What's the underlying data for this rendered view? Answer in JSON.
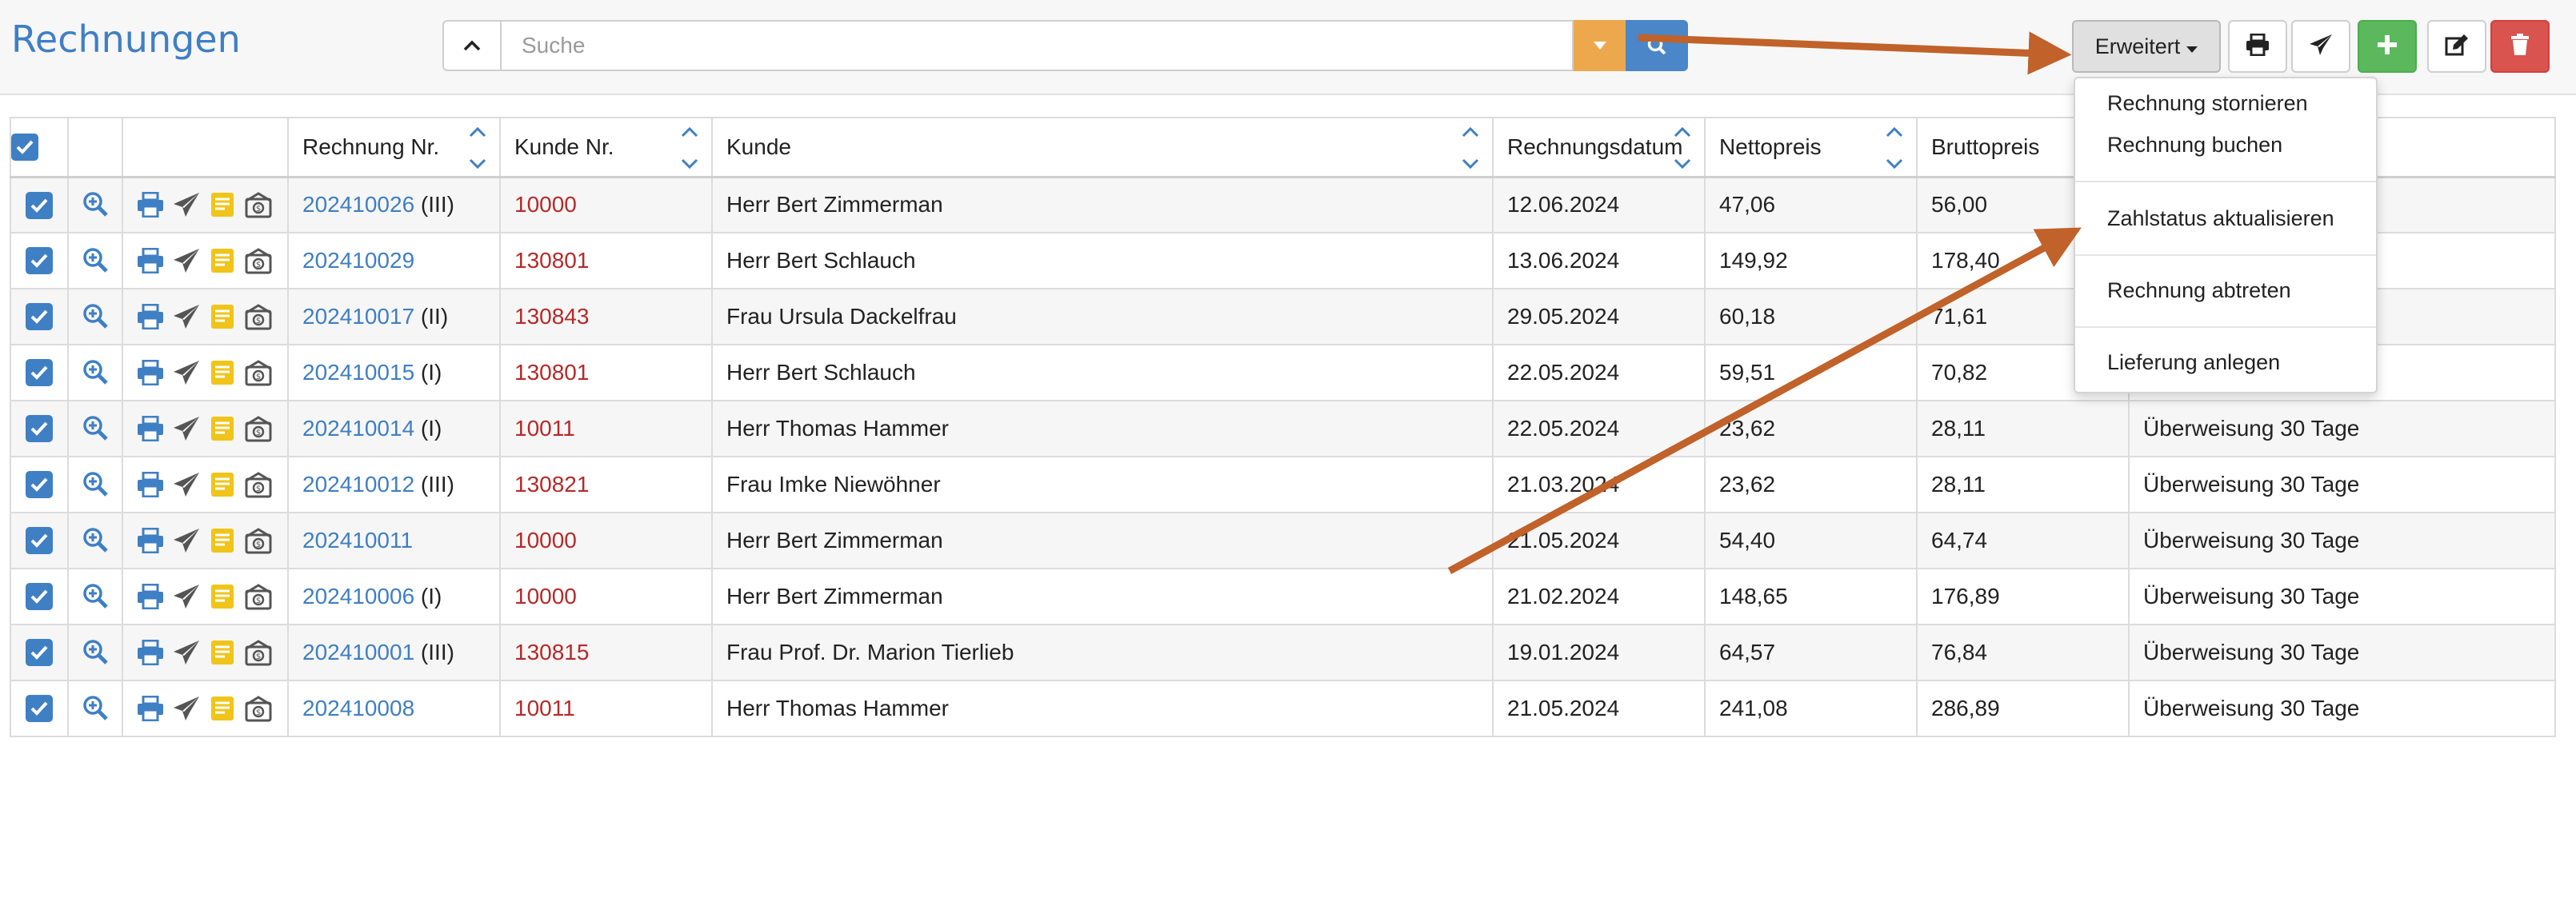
{
  "header": {
    "title": "Rechnungen",
    "search_placeholder": "Suche",
    "search_value": "",
    "erweitert_label": "Erweitert"
  },
  "dropdown": {
    "items": [
      "Rechnung stornieren",
      "Rechnung buchen",
      "Zahlstatus aktualisieren",
      "Rechnung abtreten",
      "Lieferung anlegen"
    ]
  },
  "table": {
    "headers": [
      "Rechnung Nr.",
      "Kunde Nr.",
      "Kunde",
      "Rechnungsdatum",
      "Nettopreis",
      "Bruttopreis",
      ""
    ],
    "rows": [
      {
        "nr": "202410026",
        "suffix": "(III)",
        "kunde_nr": "10000",
        "kunde": "Herr Bert Zimmerman",
        "datum": "12.06.2024",
        "netto": "47,06",
        "brutto": "56,00",
        "zahlung": ""
      },
      {
        "nr": "202410029",
        "suffix": "",
        "kunde_nr": "130801",
        "kunde": "Herr Bert Schlauch",
        "datum": "13.06.2024",
        "netto": "149,92",
        "brutto": "178,40",
        "zahlung": ""
      },
      {
        "nr": "202410017",
        "suffix": "(II)",
        "kunde_nr": "130843",
        "kunde": "Frau Ursula Dackelfrau",
        "datum": "29.05.2024",
        "netto": "60,18",
        "brutto": "71,61",
        "zahlung": ""
      },
      {
        "nr": "202410015",
        "suffix": "(I)",
        "kunde_nr": "130801",
        "kunde": "Herr Bert Schlauch",
        "datum": "22.05.2024",
        "netto": "59,51",
        "brutto": "70,82",
        "zahlung": ""
      },
      {
        "nr": "202410014",
        "suffix": "(I)",
        "kunde_nr": "10011",
        "kunde": "Herr Thomas Hammer",
        "datum": "22.05.2024",
        "netto": "23,62",
        "brutto": "28,11",
        "zahlung": "Überweisung 30 Tage"
      },
      {
        "nr": "202410012",
        "suffix": "(III)",
        "kunde_nr": "130821",
        "kunde": "Frau Imke Niewöhner",
        "datum": "21.03.2024",
        "netto": "23,62",
        "brutto": "28,11",
        "zahlung": "Überweisung 30 Tage"
      },
      {
        "nr": "202410011",
        "suffix": "",
        "kunde_nr": "10000",
        "kunde": "Herr Bert Zimmerman",
        "datum": "21.05.2024",
        "netto": "54,40",
        "brutto": "64,74",
        "zahlung": "Überweisung 30 Tage"
      },
      {
        "nr": "202410006",
        "suffix": "(I)",
        "kunde_nr": "10000",
        "kunde": "Herr Bert Zimmerman",
        "datum": "21.02.2024",
        "netto": "148,65",
        "brutto": "176,89",
        "zahlung": "Überweisung 30 Tage"
      },
      {
        "nr": "202410001",
        "suffix": "(III)",
        "kunde_nr": "130815",
        "kunde": "Frau Prof. Dr. Marion Tierlieb",
        "datum": "19.01.2024",
        "netto": "64,57",
        "brutto": "76,84",
        "zahlung": "Überweisung 30 Tage"
      },
      {
        "nr": "202410008",
        "suffix": "",
        "kunde_nr": "10011",
        "kunde": "Herr Thomas Hammer",
        "datum": "21.05.2024",
        "netto": "241,08",
        "brutto": "286,89",
        "zahlung": "Überweisung 30 Tage"
      }
    ]
  },
  "icons": {
    "row_actions": [
      "magnifier-plus-icon",
      "print-icon",
      "paper-plane-icon",
      "note-icon",
      "money-envelope-icon"
    ],
    "toolbar": [
      "print-icon",
      "paper-plane-icon",
      "plus-icon",
      "edit-icon",
      "trash-icon"
    ]
  },
  "colors": {
    "accent_blue": "#3f7fc4",
    "filter_orange": "#eda84e",
    "add_green": "#5cb85c",
    "delete_red": "#d9534f",
    "customer_number_red": "#b52a2a",
    "annotation_arrow": "#c0622a"
  }
}
